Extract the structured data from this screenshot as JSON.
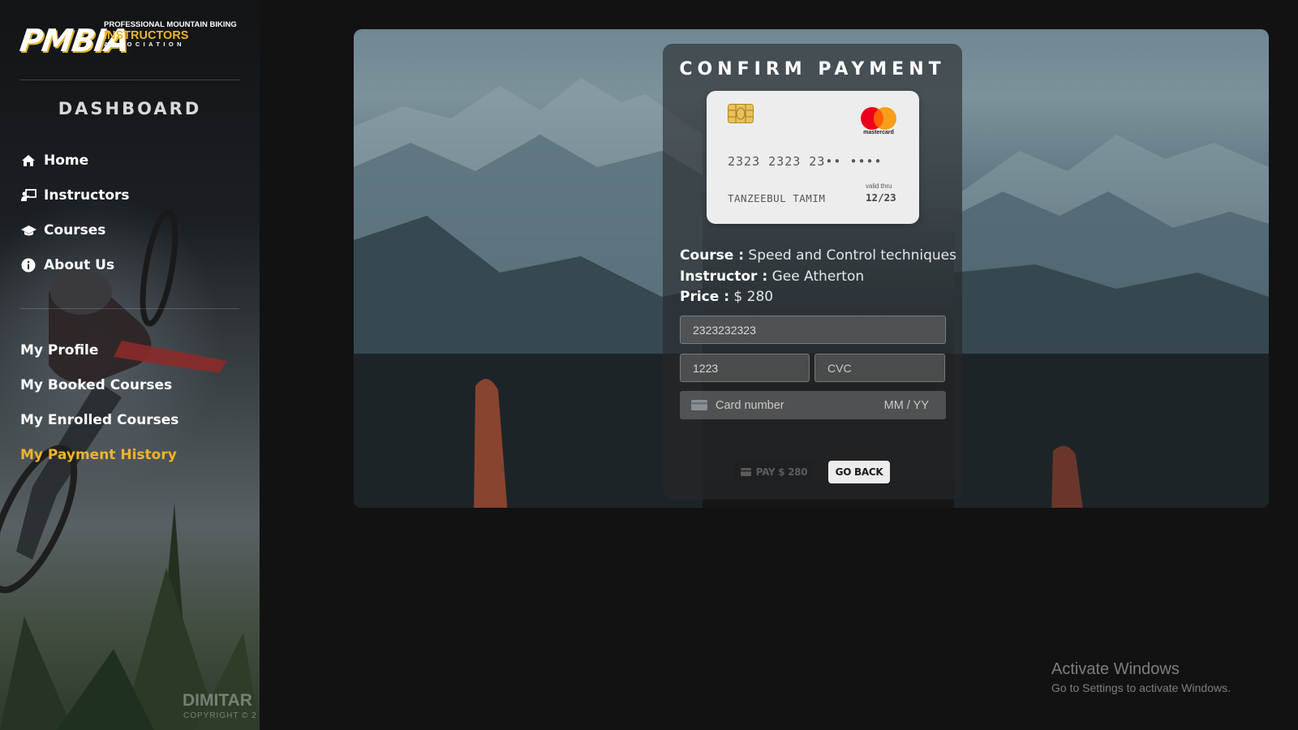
{
  "sidebar": {
    "logo": {
      "mark": "PMBIA",
      "line1": "PROFESSIONAL MOUNTAIN BIKING",
      "line2": "INSTRUCTORS",
      "line3": "ASSOCIATION"
    },
    "title": "DASHBOARD",
    "nav": [
      {
        "label": "Home",
        "icon": "home-icon"
      },
      {
        "label": "Instructors",
        "icon": "instructor-board-icon"
      },
      {
        "label": "Courses",
        "icon": "graduation-cap-icon"
      },
      {
        "label": "About Us",
        "icon": "info-icon"
      }
    ],
    "user_nav": [
      {
        "label": "My Profile"
      },
      {
        "label": "My Booked Courses"
      },
      {
        "label": "My Enrolled Courses"
      },
      {
        "label": "My Payment History",
        "active": true
      }
    ],
    "watermark": "DIMITAR",
    "watermark_sub": "COPYRIGHT © 2"
  },
  "payment": {
    "title": "CONFIRM PAYMENT",
    "card": {
      "number": "2323 2323 23•• ••••",
      "name": "TANZEEBUL TAMIM",
      "valid_label": "valid thru",
      "valid": "12/23",
      "brand": "mastercard"
    },
    "course_label": "Course :",
    "course": "Speed and Control techniques",
    "instructor_label": "Instructor :",
    "instructor": "Gee Atherton",
    "price_label": "Price :",
    "price": "$ 280",
    "card_number_value": "2323232323",
    "expiry_value": "1223",
    "cvc_placeholder": "CVC",
    "stripe_card_placeholder": "Card number",
    "stripe_expiry_placeholder": "MM / YY",
    "pay_button": "PAY $ 280",
    "back_button": "GO BACK"
  },
  "os_notice": {
    "title": "Activate Windows",
    "subtitle": "Go to Settings to activate Windows."
  },
  "colors": {
    "accent": "#f0b429",
    "background": "#121212"
  }
}
